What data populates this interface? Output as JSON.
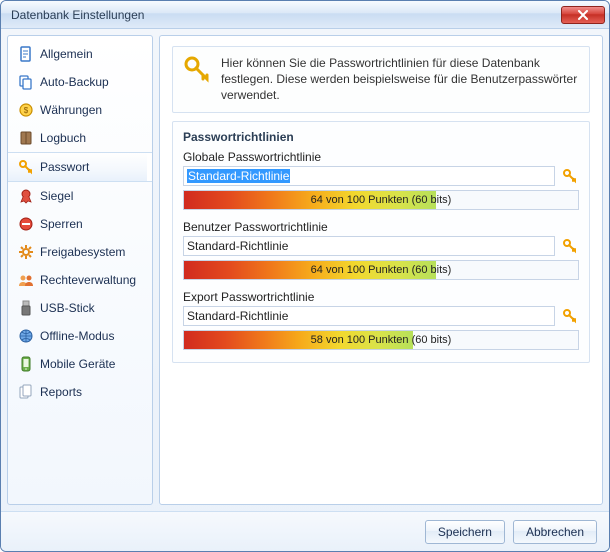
{
  "window": {
    "title": "Datenbank Einstellungen"
  },
  "sidebar": {
    "items": [
      {
        "label": "Allgemein",
        "icon": "doc",
        "color": "#3a78c9"
      },
      {
        "label": "Auto-Backup",
        "icon": "copy",
        "color": "#3a78c9"
      },
      {
        "label": "Währungen",
        "icon": "coin",
        "color": "#f2a100"
      },
      {
        "label": "Logbuch",
        "icon": "book",
        "color": "#6b4a2a"
      },
      {
        "label": "Passwort",
        "icon": "key",
        "color": "#f2a100",
        "selected": true
      },
      {
        "label": "Siegel",
        "icon": "ribbon",
        "color": "#d83a2a"
      },
      {
        "label": "Sperren",
        "icon": "minus",
        "color": "#d83a2a"
      },
      {
        "label": "Freigabesystem",
        "icon": "gear",
        "color": "#e38a1a"
      },
      {
        "label": "Rechteverwaltung",
        "icon": "users",
        "color": "#e38a1a"
      },
      {
        "label": "USB-Stick",
        "icon": "usb",
        "color": "#6b6b6b"
      },
      {
        "label": "Offline-Modus",
        "icon": "globe",
        "color": "#3a78c9"
      },
      {
        "label": "Mobile Geräte",
        "icon": "phone",
        "color": "#5aa03a"
      },
      {
        "label": "Reports",
        "icon": "docs",
        "color": "#94a6bd"
      }
    ]
  },
  "main": {
    "info_text": "Hier können Sie die Passwortrichtlinien für diese Datenbank festlegen. Diese werden beispielsweise für die Benutzerpasswörter verwendet.",
    "section_title": "Passwortrichtlinien",
    "policies": [
      {
        "label": "Globale Passwortrichtlinie",
        "value": "Standard-Richtlinie",
        "selected": true,
        "score_text": "64 von 100 Punkten",
        "bits_text": "(60 bits)",
        "score_percent": 64
      },
      {
        "label": "Benutzer Passwortrichtlinie",
        "value": "Standard-Richtlinie",
        "selected": false,
        "score_text": "64 von 100 Punkten",
        "bits_text": "(60 bits)",
        "score_percent": 64
      },
      {
        "label": "Export Passwortrichtlinie",
        "value": "Standard-Richtlinie",
        "selected": false,
        "score_text": "58 von 100 Punkten",
        "bits_text": "(60 bits)",
        "score_percent": 58
      }
    ]
  },
  "footer": {
    "save_label": "Speichern",
    "cancel_label": "Abbrechen"
  }
}
